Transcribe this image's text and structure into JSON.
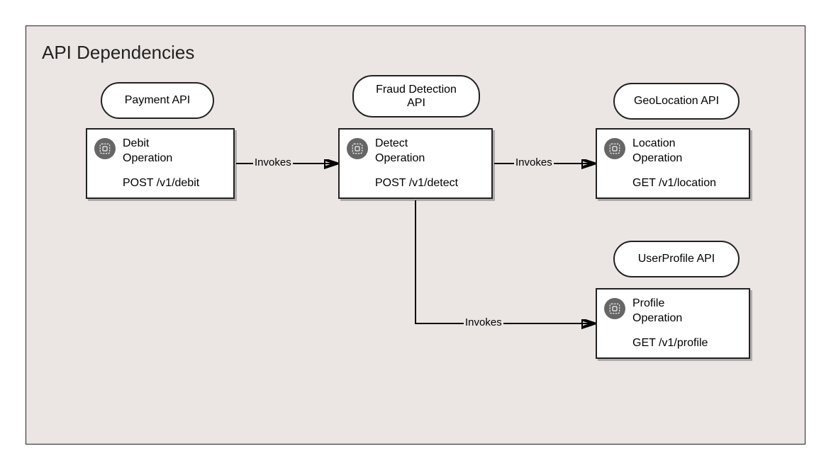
{
  "title": "API Dependencies",
  "apis": {
    "payment": {
      "label": "Payment API"
    },
    "fraud": {
      "label": "Fraud Detection API"
    },
    "geo": {
      "label": "GeoLocation API"
    },
    "profile": {
      "label": "UserProfile API"
    }
  },
  "operations": {
    "debit": {
      "name_line1": "Debit",
      "name_line2": "Operation",
      "method_path": "POST /v1/debit"
    },
    "detect": {
      "name_line1": "Detect",
      "name_line2": "Operation",
      "method_path": "POST /v1/detect"
    },
    "location": {
      "name_line1": "Location",
      "name_line2": "Operation",
      "method_path": "GET /v1/location"
    },
    "profile": {
      "name_line1": "Profile",
      "name_line2": "Operation",
      "method_path": "GET /v1/profile"
    }
  },
  "edges": {
    "e1": {
      "label": "Invokes"
    },
    "e2": {
      "label": "Invokes"
    },
    "e3": {
      "label": "Invokes"
    }
  }
}
